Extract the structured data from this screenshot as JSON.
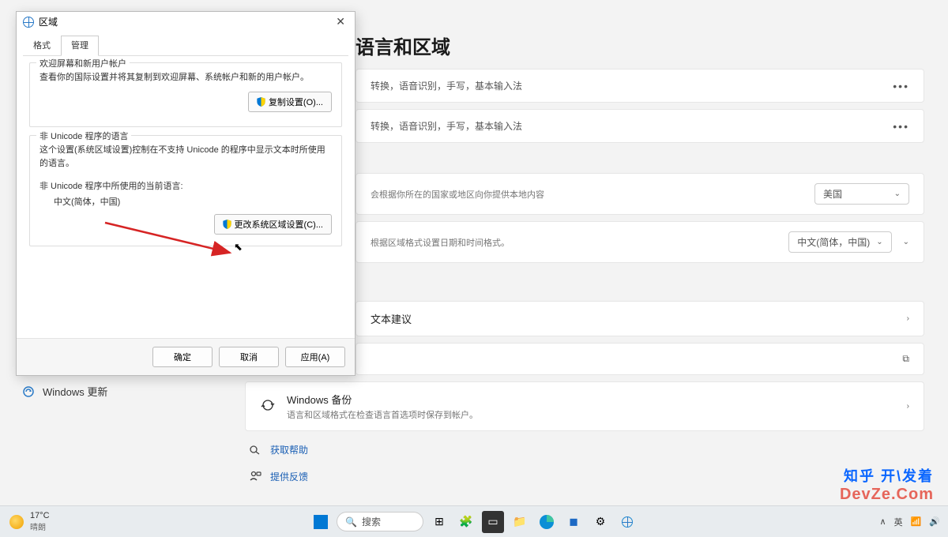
{
  "window": {
    "minimize": "—",
    "maximize": "□",
    "close": "✕"
  },
  "settings": {
    "page_title": "语言和区域",
    "lang_sub": "转换，语音识别，手写，基本输入法",
    "rows": {
      "region_label": "美国",
      "region_sub": "会根据你所在的国家或地区向你提供本地内容",
      "format_label": "中文(简体，中国)",
      "format_sub": "根据区域格式设置日期和时间格式。",
      "suggest_title": "文本建议",
      "backup_title": "Windows 备份",
      "backup_sub": "语言和区域格式在检查语言首选项时保存到帐户。"
    },
    "help": "获取帮助",
    "feedback": "提供反馈",
    "sidebar_win_update": "Windows 更新"
  },
  "dialog": {
    "title": "区域",
    "tabs": {
      "format": "格式",
      "admin": "管理"
    },
    "group1": {
      "legend": "欢迎屏幕和新用户帐户",
      "text": "查看你的国际设置并将其复制到欢迎屏幕、系统帐户和新的用户帐户。",
      "copy_btn": "复制设置(O)..."
    },
    "group2": {
      "legend": "非 Unicode 程序的语言",
      "text": "这个设置(系统区域设置)控制在不支持 Unicode 的程序中显示文本时所使用的语言。",
      "current_label": "非 Unicode 程序中所使用的当前语言:",
      "current_value": "中文(简体，中国)",
      "change_btn": "更改系统区域设置(C)..."
    },
    "buttons": {
      "ok": "确定",
      "cancel": "取消",
      "apply": "应用(A)"
    }
  },
  "taskbar": {
    "temp": "17°C",
    "weather": "晴朗",
    "search": "搜索",
    "ime": "英",
    "tray_up": "∧"
  },
  "watermark": {
    "zhihu": "知乎  开\\发着",
    "dev": "DevZe.Com"
  }
}
